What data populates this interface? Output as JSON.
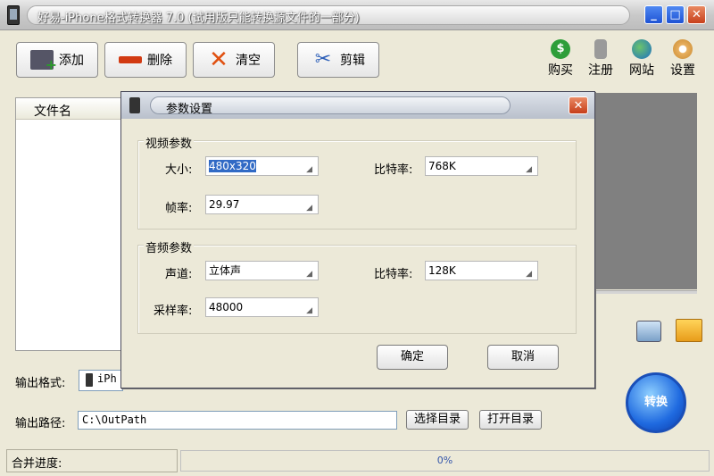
{
  "window": {
    "title": "好易-iPhone格式转换器 7.0 (试用版只能转换源文件的一部分)",
    "minimize": "_",
    "maximize": "□",
    "close": "✕"
  },
  "toolbar": {
    "add_label": "添加",
    "delete_label": "删除",
    "clear_label": "清空",
    "cut_label": "剪辑"
  },
  "top_right": {
    "buy_label": "购买",
    "buy_glyph": "$",
    "register_label": "注册",
    "website_label": "网站",
    "settings_label": "设置"
  },
  "file_list": {
    "column_header": "文件名"
  },
  "output": {
    "format_label": "输出格式:",
    "format_value": "iPh",
    "path_label": "输出路径:",
    "path_value": "C:\\OutPath",
    "choose_dir_label": "选择目录",
    "open_dir_label": "打开目录"
  },
  "convert": {
    "label": "转换"
  },
  "status": {
    "merge_label": "合并进度:",
    "progress_text": "0%"
  },
  "dialog": {
    "title": "参数设置",
    "video_group": "视频参数",
    "size_label": "大小:",
    "size_value": "480x320",
    "video_bitrate_label": "比特率:",
    "video_bitrate_value": "768K",
    "framerate_label": "帧率:",
    "framerate_value": "29.97",
    "audio_group": "音频参数",
    "channel_label": "声道:",
    "channel_value": "立体声",
    "audio_bitrate_label": "比特率:",
    "audio_bitrate_value": "128K",
    "samplerate_label": "采样率:",
    "samplerate_value": "48000",
    "ok_label": "确定",
    "cancel_label": "取消",
    "close": "✕"
  },
  "colors": {
    "accent": "#316ac5",
    "close_red": "#c63e1a",
    "preview_gray": "#808080"
  }
}
